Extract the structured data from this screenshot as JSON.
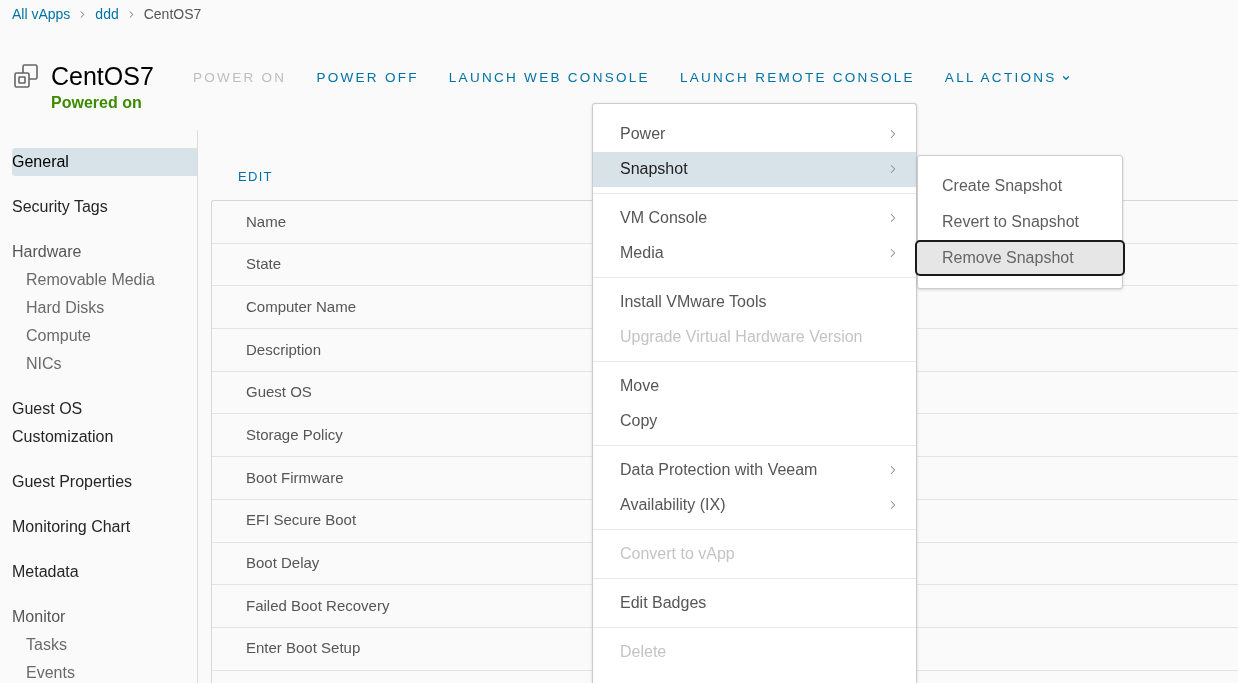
{
  "breadcrumb": [
    {
      "label": "All vApps",
      "kind": "link"
    },
    {
      "label": "ddd",
      "kind": "link"
    },
    {
      "label": "CentOS7",
      "kind": "current"
    }
  ],
  "header": {
    "title": "CentOS7",
    "status": "Powered on"
  },
  "actions": [
    {
      "label": "POWER ON",
      "kind": "link",
      "disabled": true
    },
    {
      "label": "POWER OFF",
      "kind": "link",
      "disabled": false
    },
    {
      "label": "LAUNCH WEB CONSOLE",
      "kind": "link",
      "disabled": false
    },
    {
      "label": "LAUNCH REMOTE CONSOLE",
      "kind": "link",
      "disabled": false
    },
    {
      "label": "ALL ACTIONS",
      "kind": "dropdown",
      "disabled": false
    }
  ],
  "sidebar": {
    "items": [
      {
        "label": "General",
        "selected": true
      },
      {
        "label": "Security Tags",
        "selected": false
      },
      {
        "label": "Hardware",
        "selected": false,
        "children": [
          {
            "label": "Removable Media",
            "selected": false
          },
          {
            "label": "Hard Disks",
            "selected": false
          },
          {
            "label": "Compute",
            "selected": false
          },
          {
            "label": "NICs",
            "selected": false
          }
        ]
      },
      {
        "label": "Guest OS Customization",
        "selected": false
      },
      {
        "label": "Guest Properties",
        "selected": false
      },
      {
        "label": "Monitoring Chart",
        "selected": false
      },
      {
        "label": "Metadata",
        "selected": false
      },
      {
        "label": "Monitor",
        "selected": false,
        "children": [
          {
            "label": "Tasks",
            "selected": false
          },
          {
            "label": "Events",
            "selected": false
          }
        ]
      }
    ]
  },
  "edit_link": "EDIT",
  "properties_table": {
    "rows": [
      {
        "label": "Name"
      },
      {
        "label": "State"
      },
      {
        "label": "Computer Name"
      },
      {
        "label": "Description"
      },
      {
        "label": "Guest OS"
      },
      {
        "label": "Storage Policy"
      },
      {
        "label": "Boot Firmware"
      },
      {
        "label": "EFI Secure Boot"
      },
      {
        "label": "Boot Delay"
      },
      {
        "label": "Failed Boot Recovery"
      },
      {
        "label": "Enter Boot Setup"
      }
    ]
  },
  "context_menu": {
    "groups": [
      {
        "items": [
          {
            "label": "Power",
            "kind": "submenu",
            "disabled": false,
            "selected": false
          },
          {
            "label": "Snapshot",
            "kind": "submenu",
            "disabled": false,
            "selected": true
          }
        ]
      },
      {
        "items": [
          {
            "label": "VM Console",
            "kind": "submenu",
            "disabled": false,
            "selected": false
          },
          {
            "label": "Media",
            "kind": "submenu",
            "disabled": false,
            "selected": false
          }
        ]
      },
      {
        "items": [
          {
            "label": "Install VMware Tools",
            "kind": "action",
            "disabled": false,
            "selected": false
          },
          {
            "label": "Upgrade Virtual Hardware Version",
            "kind": "action",
            "disabled": true,
            "selected": false
          }
        ]
      },
      {
        "items": [
          {
            "label": "Move",
            "kind": "action",
            "disabled": false,
            "selected": false
          },
          {
            "label": "Copy",
            "kind": "action",
            "disabled": false,
            "selected": false
          }
        ]
      },
      {
        "items": [
          {
            "label": "Data Protection with Veeam",
            "kind": "submenu",
            "disabled": false,
            "selected": false
          },
          {
            "label": "Availability (IX)",
            "kind": "submenu",
            "disabled": false,
            "selected": false
          }
        ]
      },
      {
        "items": [
          {
            "label": "Convert to vApp",
            "kind": "action",
            "disabled": true,
            "selected": false
          }
        ]
      },
      {
        "items": [
          {
            "label": "Edit Badges",
            "kind": "action",
            "disabled": false,
            "selected": false
          }
        ]
      },
      {
        "items": [
          {
            "label": "Delete",
            "kind": "action",
            "disabled": true,
            "selected": false
          }
        ]
      }
    ]
  },
  "submenu": {
    "items": [
      {
        "label": "Create Snapshot",
        "selected": false
      },
      {
        "label": "Revert to Snapshot",
        "selected": false
      },
      {
        "label": "Remove Snapshot",
        "selected": true
      }
    ]
  }
}
